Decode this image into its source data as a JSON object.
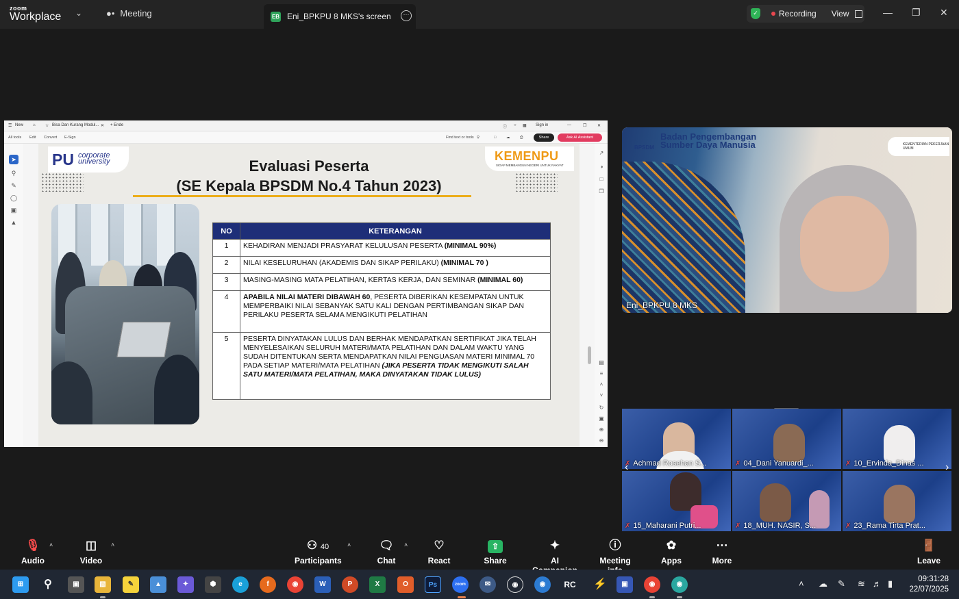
{
  "titlebar": {
    "logo_small": "zoom",
    "logo_big": "Workplace",
    "meeting_tab": "Meeting",
    "screen_tab_badge": "EB",
    "screen_tab_label": "Eni_BPKPU 8 MKS's screen",
    "recording_label": "Recording",
    "view_label": "View"
  },
  "browser": {
    "tab_new": "New",
    "tab_title": "Bisa Dan Kurang Modul...",
    "tab_add": "+ Ende",
    "sign_in": "Sign in",
    "menu_all_tools": "All tools",
    "menu_edit": "Edit",
    "menu_convert": "Convert",
    "menu_esign": "E-Sign",
    "find_text": "Find text or tools",
    "share": "Share",
    "ai_assistant": "Ask AI Assistant"
  },
  "slide": {
    "pu_mark": "PU",
    "pu_text_1": "corporate",
    "pu_text_2": "university",
    "kemen_logo": "KEMENPU",
    "kemen_sub": "SIGAP MEMBANGUN NEGERI UNTUK RAKYAT",
    "title_1": "Evaluasi Peserta",
    "title_2": "(SE Kepala BPSDM No.4 Tahun 2023)",
    "table": {
      "col_no": "NO",
      "col_ket": "KETERANGAN",
      "rows": [
        {
          "no": "1",
          "text": "KEHADIRAN MENJADI PRASYARAT KELULUSAN PESERTA ",
          "bold": "(MINIMAL 90%)"
        },
        {
          "no": "2",
          "text": "NILAI KESELURUHAN (AKADEMIS DAN SIKAP PERILAKU) ",
          "bold": "(MINIMAL 70 )"
        },
        {
          "no": "3",
          "text": "MASING-MASING MATA PELATIHAN, KERTAS KERJA, DAN SEMINAR ",
          "bold": "(MINIMAL 60)"
        },
        {
          "no": "4",
          "bold_lead": "APABILA NILAI MATERI DIBAWAH 60",
          "text": ", PESERTA DIBERIKAN KESEMPATAN UNTUK MEMPERBAIKI NILAI SEBANYAK SATU KALI DENGAN PERTIMBANGAN SIKAP DAN PERILAKU PESERTA SELAMA MENGIKUTI PELATIHAN"
        },
        {
          "no": "5",
          "text": "PESERTA DINYATAKAN LULUS DAN BERHAK MENDAPATKAN SERTIFIKAT JIKA TELAH MENYELESAIKAN SELURUH MATERI/MATA PELATIHAN DAN DALAM WAKTU YANG SUDAH DITENTUKAN SERTA  MENDAPATKAN NILAI PENGUASAN MATERI MINIMAL 70 PADA SETIAP MATERI/MATA PELATIHAN ",
          "italic": "(JIKA PESERTA TIDAK MENGIKUTI SALAH SATU MATERI/MATA PELATIHAN, MAKA DINYATAKAN TIDAK LULUS)"
        }
      ]
    }
  },
  "speaker": {
    "org_line_1": "Badan Pengembangan",
    "org_line_2": "Sumber Daya Manusia",
    "org_abbr": "BPSDM",
    "ministry": "KEMENTERIAN PEKERJAAN UMUM",
    "name": "Eni_BPKPU 8 MKS"
  },
  "participants": [
    {
      "name": "Achmad Rosehan S..."
    },
    {
      "name": "04_Dani Yanuardi_..."
    },
    {
      "name": "10_Ervinda_Dinas ..."
    },
    {
      "name": "15_Maharani Putri..."
    },
    {
      "name": "18_MUH. NASIR, S..."
    },
    {
      "name": "23_Rama Tirta Prat..."
    }
  ],
  "toolbar": {
    "audio": "Audio",
    "video": "Video",
    "participants": "Participants",
    "participants_count": "40",
    "chat": "Chat",
    "react": "React",
    "share": "Share",
    "ai_companion": "AI Companion",
    "meeting_info": "Meeting info",
    "apps": "Apps",
    "more": "More",
    "leave": "Leave"
  },
  "taskbar": {
    "time": "09:31:28",
    "date": "22/07/2025"
  },
  "colors": {
    "recording_dot": "#e8474f",
    "shield": "#2fb457",
    "table_header": "#1e2e78",
    "title_underline": "#ecad1a",
    "share_green": "#28b463"
  }
}
